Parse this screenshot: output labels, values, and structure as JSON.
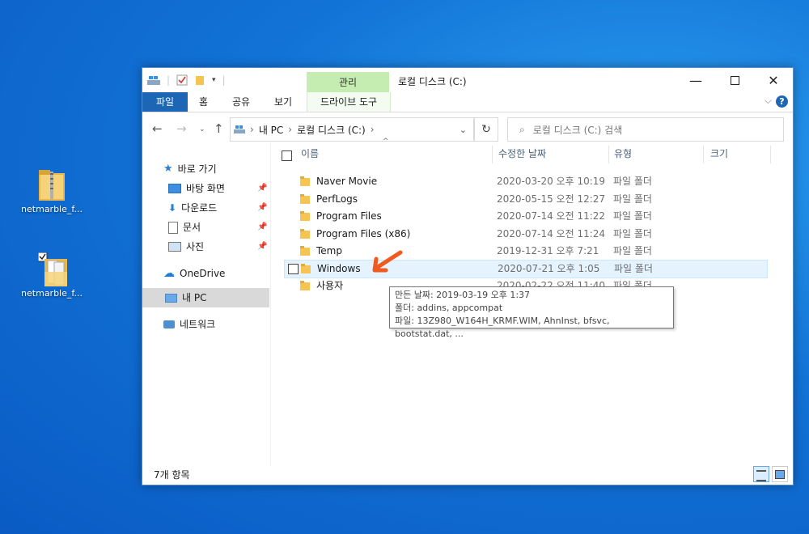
{
  "desktop": {
    "icons": [
      {
        "label": "netmarble_f..."
      },
      {
        "label": "netmarble_f..."
      }
    ]
  },
  "window": {
    "manage_tab": "관리",
    "title": "로컬 디스크 (C:)",
    "ribbon_tabs": [
      "파일",
      "홈",
      "공유",
      "보기",
      "드라이브 도구"
    ],
    "help": "?",
    "nav": {
      "address": [
        "내 PC",
        "로컬 디스크 (C:)"
      ],
      "search_placeholder": "로컬 디스크 (C:) 검색"
    },
    "sidebar": {
      "quick_access": "바로 가기",
      "quick_items": [
        "바탕 화면",
        "다운로드",
        "문서",
        "사진"
      ],
      "onedrive": "OneDrive",
      "this_pc": "내 PC",
      "network": "네트워크"
    },
    "columns": {
      "name": "이름",
      "date": "수정한 날짜",
      "type": "유형",
      "size": "크기"
    },
    "files": [
      {
        "name": "Naver Movie",
        "date": "2020-03-20 오후 10:19",
        "type": "파일 폴더"
      },
      {
        "name": "PerfLogs",
        "date": "2020-05-15 오전 12:27",
        "type": "파일 폴더"
      },
      {
        "name": "Program Files",
        "date": "2020-07-14 오전 11:22",
        "type": "파일 폴더"
      },
      {
        "name": "Program Files (x86)",
        "date": "2020-07-14 오전 11:24",
        "type": "파일 폴더"
      },
      {
        "name": "Temp",
        "date": "2019-12-31 오후 7:21",
        "type": "파일 폴더"
      },
      {
        "name": "Windows",
        "date": "2020-07-21 오후 1:05",
        "type": "파일 폴더"
      },
      {
        "name": "사용자",
        "date": "2020-02-22 오전 11:40",
        "type": "파일 폴더"
      }
    ],
    "tooltip": {
      "line1": "만든 날짜: 2019-03-19 오후 1:37",
      "line2": "폴더: addins, appcompat",
      "line3": "파일: 13Z980_W164H_KRMF.WIM, AhnInst, bfsvc, bootstat.dat, ..."
    },
    "status": "7개 항목"
  },
  "colors": {
    "accent": "#1c66b5",
    "manage_tab_bg": "#c5ecb1",
    "selection": "#e5f3ff",
    "annotation_arrow": "#f05a1e"
  }
}
